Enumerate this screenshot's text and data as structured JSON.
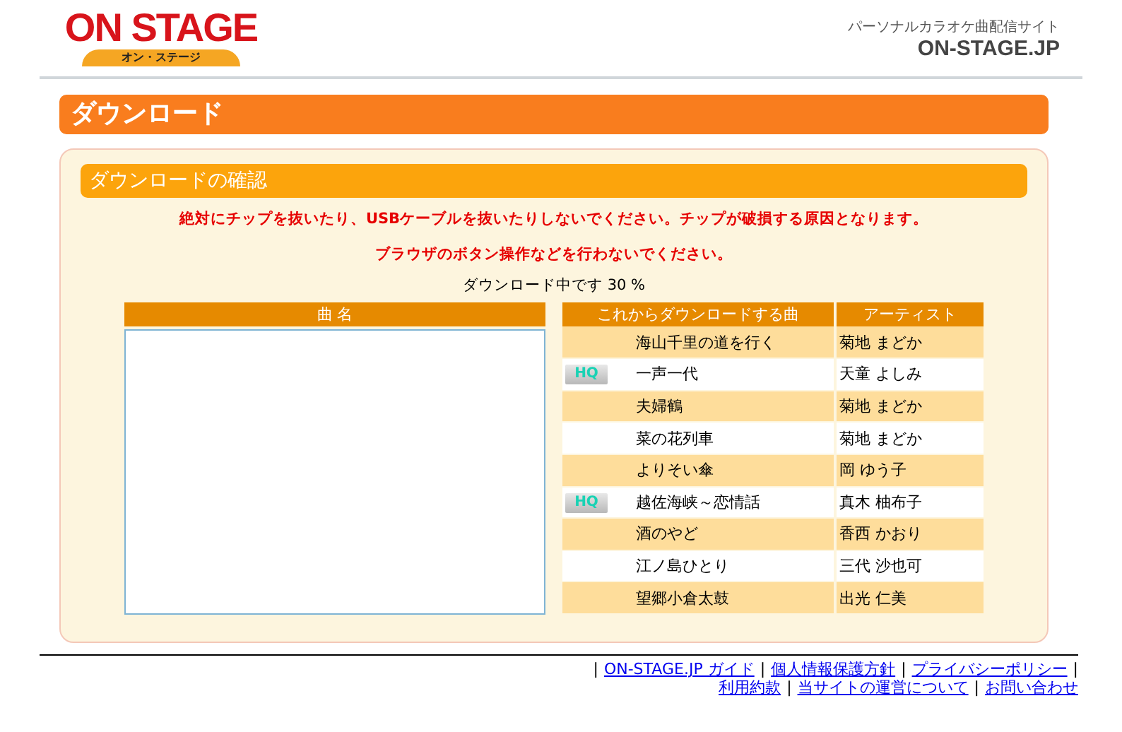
{
  "logo": {
    "title": "ON STAGE",
    "subtitle": "オン・ステージ"
  },
  "site": {
    "tagline": "パーソナルカラオケ曲配信サイト",
    "domain": "ON-STAGE.JP"
  },
  "page_title": "ダウンロード",
  "section_title": "ダウンロードの確認",
  "warnings": [
    "絶対にチップを抜いたり、USBケーブルを抜いたりしないでください。チップが破損する原因となります。",
    "ブラウザのボタン操作などを行わないでください。"
  ],
  "progress_text": "ダウンロード中です 30 %",
  "song_list": {
    "heading": "曲 名"
  },
  "queue": {
    "columns": [
      "これからダウンロードする曲",
      "アーティスト"
    ],
    "rows": [
      {
        "hq": false,
        "title": "海山千里の道を行く",
        "artist": "菊地 まどか"
      },
      {
        "hq": true,
        "badge": "HQ",
        "title": "一声一代",
        "artist": "天童 よしみ"
      },
      {
        "hq": false,
        "title": "夫婦鶴",
        "artist": "菊地 まどか"
      },
      {
        "hq": false,
        "title": "菜の花列車",
        "artist": "菊地 まどか"
      },
      {
        "hq": false,
        "title": "よりそい傘",
        "artist": "岡 ゆう子"
      },
      {
        "hq": true,
        "badge": "HQ",
        "title": "越佐海峡～恋情話",
        "artist": "真木 柚布子"
      },
      {
        "hq": false,
        "title": "酒のやど",
        "artist": "香西 かおり"
      },
      {
        "hq": false,
        "title": "江ノ島ひとり",
        "artist": "三代 沙也可"
      },
      {
        "hq": false,
        "title": "望郷小倉太鼓",
        "artist": "出光 仁美"
      }
    ]
  },
  "footer": {
    "lines": [
      [
        {
          "kind": "sep",
          "text": "|"
        },
        {
          "kind": "link",
          "text": "ON-STAGE.JP ガイド"
        },
        {
          "kind": "sep",
          "text": "|"
        },
        {
          "kind": "link",
          "text": "個人情報保護方針"
        },
        {
          "kind": "sep",
          "text": "|"
        },
        {
          "kind": "link",
          "text": "プライバシーポリシー"
        },
        {
          "kind": "sep",
          "text": "|"
        }
      ],
      [
        {
          "kind": "link",
          "text": "利用約款"
        },
        {
          "kind": "sep",
          "text": "|"
        },
        {
          "kind": "link",
          "text": "当サイトの運営について"
        },
        {
          "kind": "sep",
          "text": "|"
        },
        {
          "kind": "link",
          "text": "お問い合わせ"
        }
      ]
    ]
  }
}
